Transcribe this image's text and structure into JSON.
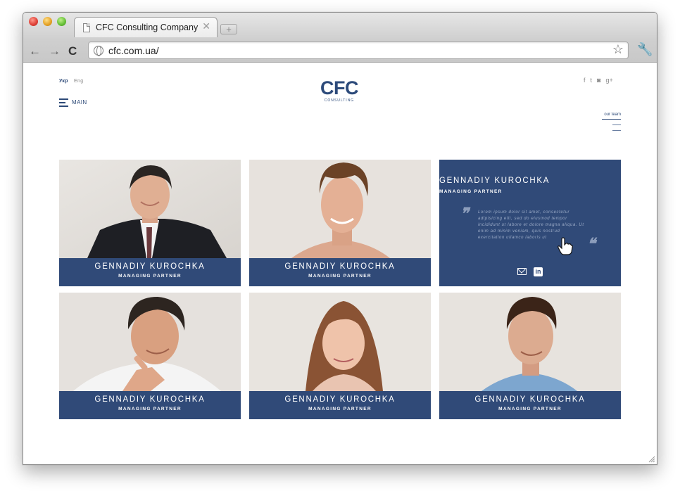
{
  "browser": {
    "tab_title": "CFC Consulting Company",
    "tab_close": "✕",
    "new_tab": "+",
    "url": "cfc.com.ua/",
    "icons": {
      "back": "←",
      "forward": "→",
      "reload": "C",
      "star": "☆",
      "wrench": "🔧"
    }
  },
  "header": {
    "lang_active": "Укр",
    "lang_inactive": "Eng",
    "menu_label": "MAIN",
    "logo_mark": "CFC",
    "logo_sub": "CONSULTING",
    "social": [
      "f",
      "t",
      "◙",
      "g+"
    ],
    "side_nav_label": "our team"
  },
  "team": [
    {
      "name": "GENNADIY KUROCHKA",
      "role": "MANAGING PARTNER"
    },
    {
      "name": "GENNADIY KUROCHKA",
      "role": "MANAGING PARTNER"
    },
    {
      "name": "GENNADIY KUROCHKA",
      "role": "MANAGING PARTNER",
      "quote": "Lorem ipsum dolor sit amet, consectetur adipisicing elit, sed do eiusmod tempor incididunt ut labore et dolore magna aliqua. Ut enim ad minim veniam, quis nostrud exercitation ullamco laboris ut",
      "quote_open": "❞",
      "quote_close": "❝"
    },
    {
      "name": "GENNADIY KUROCHKA",
      "role": "MANAGING PARTNER"
    },
    {
      "name": "GENNADIY KUROCHKA",
      "role": "MANAGING PARTNER"
    },
    {
      "name": "GENNADIY KUROCHKA",
      "role": "MANAGING PARTNER"
    }
  ],
  "colors": {
    "brand_navy": "#304a78",
    "chrome_gray": "#cfcfcf"
  }
}
